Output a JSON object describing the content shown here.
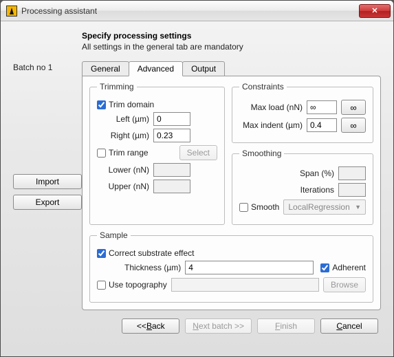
{
  "window": {
    "title": "Processing assistant"
  },
  "header": {
    "heading": "Specify processing settings",
    "subheading": "All settings in the general tab are mandatory"
  },
  "batch": {
    "label": "Batch no 1"
  },
  "side": {
    "import": "Import",
    "export": "Export"
  },
  "tabs": {
    "general": "General",
    "advanced": "Advanced",
    "output": "Output"
  },
  "trimming": {
    "legend": "Trimming",
    "trim_domain_label": "Trim domain",
    "left_label": "Left (µm)",
    "left_value": "0",
    "right_label": "Right (µm)",
    "right_value": "0.23",
    "trim_range_label": "Trim range",
    "select_btn": "Select",
    "lower_label": "Lower (nN)",
    "lower_value": "",
    "upper_label": "Upper (nN)",
    "upper_value": ""
  },
  "constraints": {
    "legend": "Constraints",
    "max_load_label": "Max load (nN)",
    "max_load_value": "∞",
    "max_indent_label": "Max indent (µm)",
    "max_indent_value": "0.4",
    "inf_btn": "∞"
  },
  "smoothing": {
    "legend": "Smoothing",
    "span_label": "Span (%)",
    "span_value": "",
    "iterations_label": "Iterations",
    "iterations_value": "",
    "smooth_label": "Smooth",
    "method": "LocalRegression"
  },
  "sample": {
    "legend": "Sample",
    "correct_label": "Correct substrate effect",
    "thickness_label": "Thickness (µm)",
    "thickness_value": "4",
    "adherent_label": "Adherent",
    "use_topography_label": "Use topography",
    "browse_btn": "Browse"
  },
  "footer": {
    "back": "Back",
    "back_prefix": "<<  ",
    "next": "Next batch >>",
    "finish": "Finish",
    "cancel": "Cancel"
  }
}
